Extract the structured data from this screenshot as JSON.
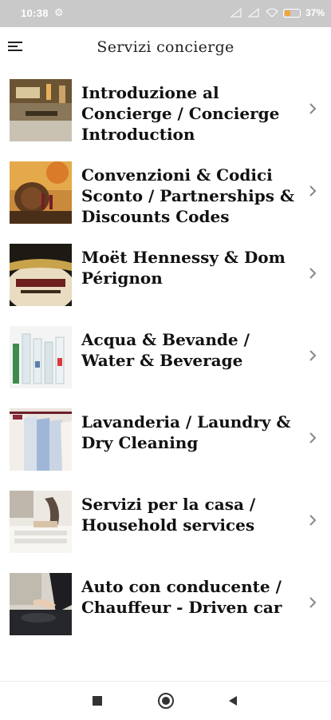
{
  "status_bar": {
    "time": "10:38",
    "battery": "37",
    "battery_level": 0.37
  },
  "app_bar": {
    "title": "Servizi concierge"
  },
  "items": [
    {
      "label": "Introduzione al Concierge / Concierge Introduction",
      "icon": "concierge-desk-photo"
    },
    {
      "label": "Convenzioni & Codici Sconto / Partnerships & Discounts Codes",
      "icon": "wine-barrels-photo"
    },
    {
      "label": "Moët Hennessy & Dom Pérignon",
      "icon": "champagne-bottle-photo"
    },
    {
      "label": "Acqua & Bevande / Water & Beverage",
      "icon": "water-bottles-photo"
    },
    {
      "label": "Lavanderia / Laundry & Dry Cleaning",
      "icon": "shirts-hanging-photo"
    },
    {
      "label": "Servizi per la casa / Household services",
      "icon": "towels-photo"
    },
    {
      "label": "Auto con conducente / Chauffeur - Driven car",
      "icon": "chauffeur-photo"
    }
  ],
  "nav": {
    "buttons": [
      "recents-button",
      "home-button",
      "back-button"
    ]
  },
  "colors": {
    "status_bar": "#c9c9c9",
    "battery_fill": "#f0a63a",
    "chevron": "#888888"
  }
}
